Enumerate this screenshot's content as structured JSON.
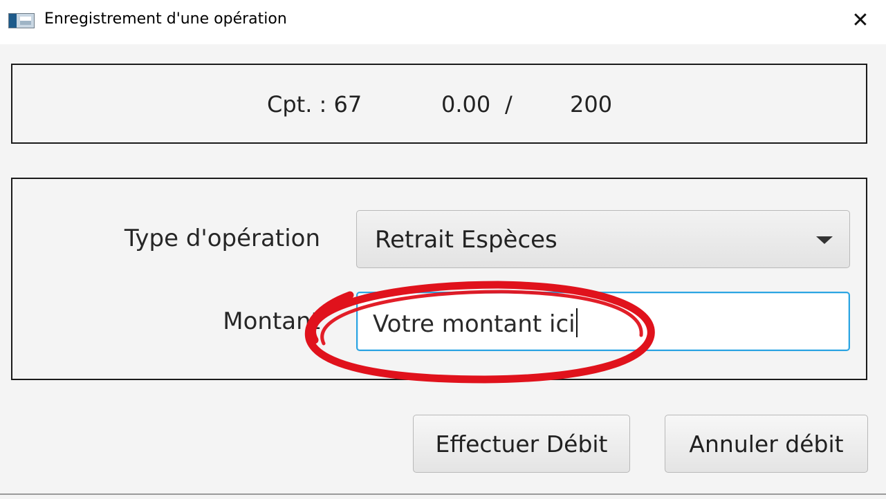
{
  "window": {
    "title": "Enregistrement d'une opération",
    "close_glyph": "✕",
    "icon_name": "app-window-icon"
  },
  "info": {
    "account": "Cpt. : 67",
    "balance": "0.00",
    "separator": "/",
    "limit": "200"
  },
  "form": {
    "type_label": "Type d'opération",
    "type_value": "Retrait Espèces",
    "amount_label": "Montant",
    "amount_value": "Votre montant ici"
  },
  "buttons": {
    "debit": "Effectuer Débit",
    "cancel": "Annuler débit"
  },
  "colors": {
    "focus_border": "#2ba4e2",
    "annotation": "#e0121c"
  }
}
